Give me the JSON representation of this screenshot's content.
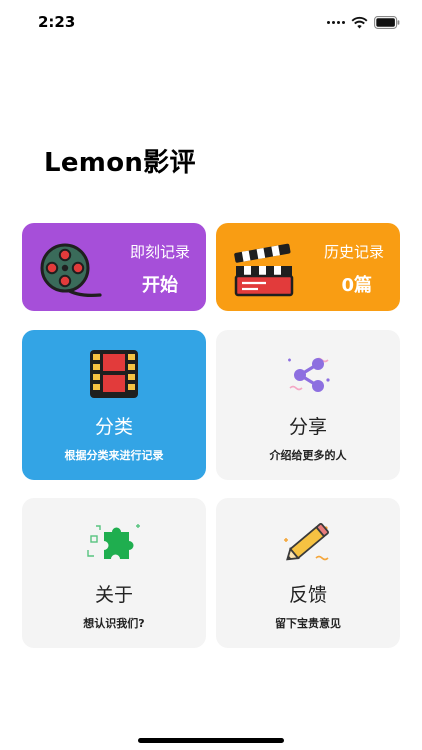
{
  "status_bar": {
    "time": "2:23"
  },
  "app": {
    "title": "Lemon影评"
  },
  "cards": {
    "record": {
      "label": "即刻记录",
      "value": "开始",
      "icon": "film-reel-icon",
      "color": "#a64fd9"
    },
    "history": {
      "label": "历史记录",
      "value": "0篇",
      "icon": "clapperboard-icon",
      "color": "#f99d13"
    },
    "category": {
      "title": "分类",
      "subtitle": "根据分类来进行记录",
      "icon": "film-strip-icon",
      "color": "#33a4e5"
    },
    "share": {
      "title": "分享",
      "subtitle": "介绍给更多的人",
      "icon": "share-icon",
      "color": "#f4f4f4"
    },
    "about": {
      "title": "关于",
      "subtitle": "想认识我们?",
      "icon": "puzzle-piece-icon",
      "color": "#f4f4f4"
    },
    "feedback": {
      "title": "反馈",
      "subtitle": "留下宝贵意见",
      "icon": "pencil-icon",
      "color": "#f4f4f4"
    }
  }
}
